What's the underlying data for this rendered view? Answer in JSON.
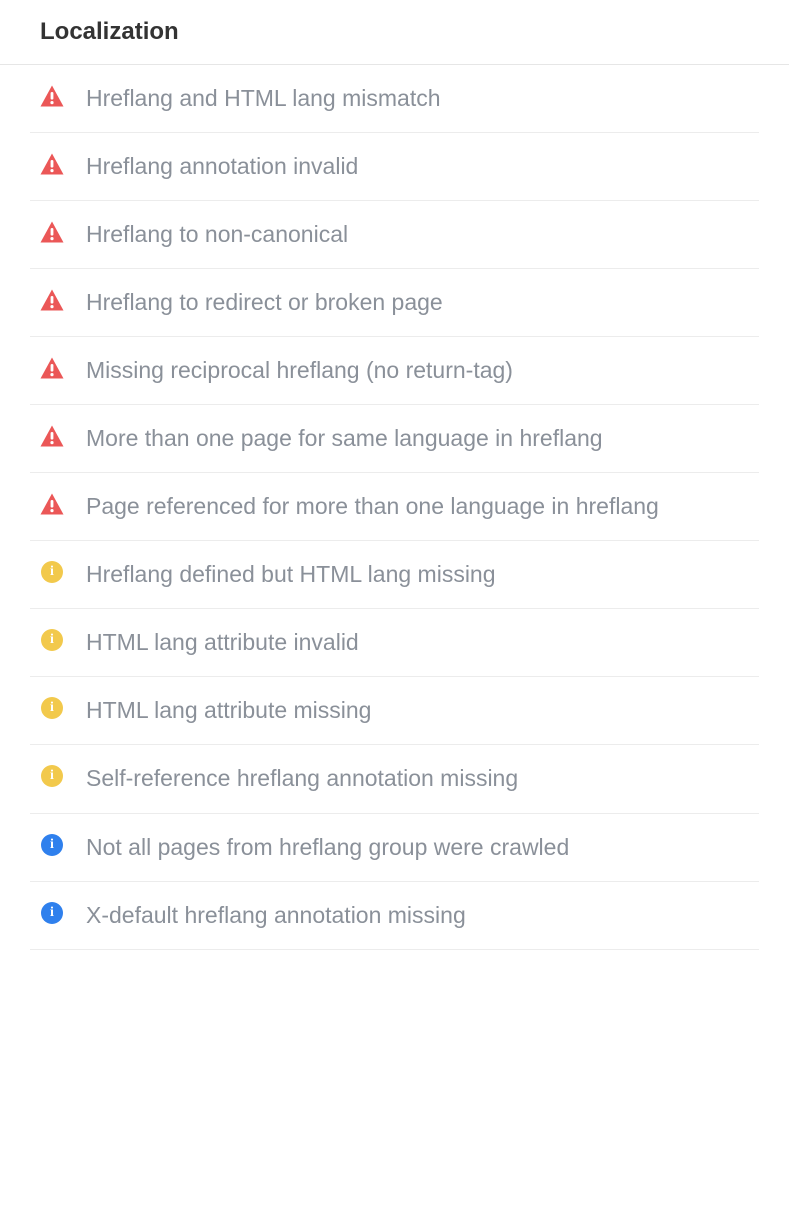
{
  "section": {
    "title": "Localization"
  },
  "issues": [
    {
      "severity": "error",
      "label": "Hreflang and HTML lang mismatch"
    },
    {
      "severity": "error",
      "label": "Hreflang annotation invalid"
    },
    {
      "severity": "error",
      "label": "Hreflang to non-canonical"
    },
    {
      "severity": "error",
      "label": "Hreflang to redirect or broken page"
    },
    {
      "severity": "error",
      "label": "Missing reciprocal hreflang (no return-tag)"
    },
    {
      "severity": "error",
      "label": "More than one page for same language in hreflang"
    },
    {
      "severity": "error",
      "label": "Page referenced for more than one language in hreflang"
    },
    {
      "severity": "warning",
      "label": "Hreflang defined but HTML lang missing"
    },
    {
      "severity": "warning",
      "label": "HTML lang attribute invalid"
    },
    {
      "severity": "warning",
      "label": "HTML lang attribute missing"
    },
    {
      "severity": "warning",
      "label": "Self-reference hreflang annotation missing"
    },
    {
      "severity": "info",
      "label": "Not all pages from hreflang group were crawled"
    },
    {
      "severity": "info",
      "label": "X-default hreflang annotation missing"
    }
  ],
  "colors": {
    "error": "#eb5757",
    "warning": "#f2c94c",
    "info": "#2f80ed",
    "text": "#8a9099"
  }
}
